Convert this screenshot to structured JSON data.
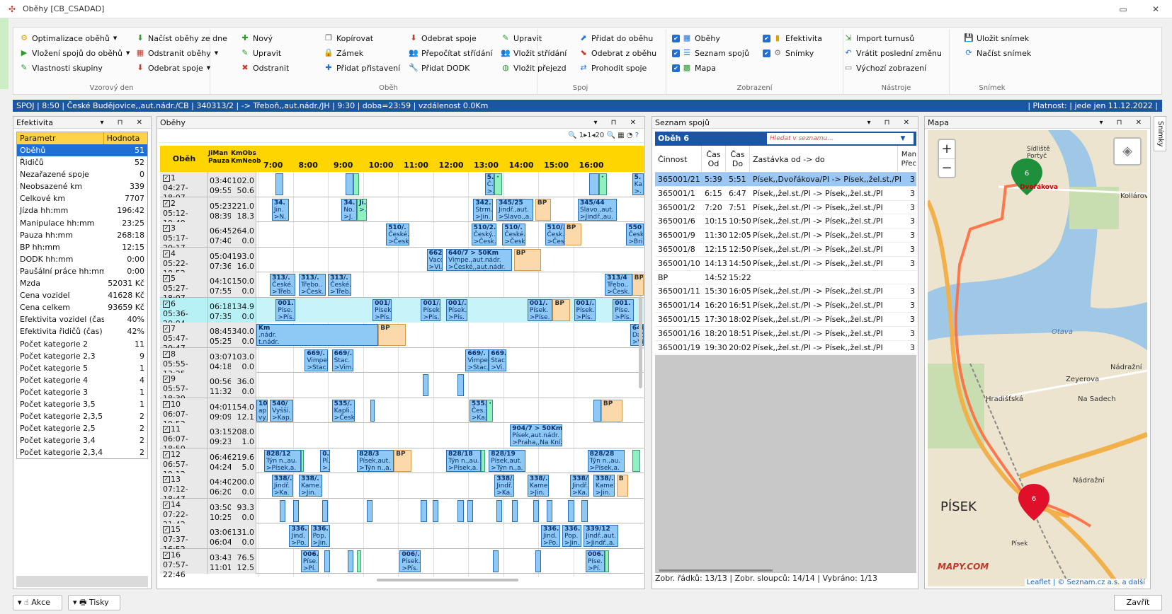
{
  "window": {
    "title": "Oběhy [CB_CSADAD]",
    "minimize": "▭",
    "close": "✕"
  },
  "ribbon": {
    "groups": {
      "vzorovy": {
        "title": "Vzorový den",
        "items": [
          "Optimalizace oběhů",
          "Vložení spojů do oběhů",
          "Vlastnosti skupiny",
          "Načíst oběhy ze dne",
          "Odstranit oběhy",
          "Odebrat spoje"
        ]
      },
      "obeh": {
        "title": "Oběh",
        "items": [
          "Nový",
          "Upravit",
          "Odstranit",
          "Kopírovat",
          "Zámek",
          "Přidat přistavení",
          "Odebrat spoje",
          "Přepočítat střídání",
          "Přidat DODK"
        ]
      },
      "spoj": {
        "title": "Spoj",
        "items": [
          "Upravit",
          "Vložit střídání",
          "Vložit přejezd",
          "Přidat do oběhu",
          "Odebrat z oběhu",
          "Prohodit spoje"
        ]
      },
      "zobrazeni": {
        "title": "Zobrazení",
        "items": [
          "Oběhy",
          "Seznam spojů",
          "Mapa",
          "Efektivita",
          "Snímky"
        ]
      },
      "nastroje": {
        "title": "Nástroje",
        "items": [
          "Import turnusů",
          "Vrátit poslední změnu",
          "Výchozí zobrazení"
        ]
      },
      "snimek": {
        "title": "Snímek",
        "items": [
          "Uložit snímek",
          "Načíst snímek"
        ]
      }
    }
  },
  "status": {
    "left": "SPOJ | 8:50 | České Budějovice,,aut.nádr./CB | 340313/2 |  -> Třeboň,,aut.nádr./JH | 9:30 | doba=23:59 | vzdálenost 0.0Km",
    "right": "| Platnost:  | jede jen 11.12.2022 |"
  },
  "efektivita": {
    "title": "Efektivita",
    "headers": [
      "Parametr",
      "Hodnota"
    ],
    "rows": [
      [
        "Oběhů",
        "51"
      ],
      [
        "Řidičů",
        "52"
      ],
      [
        "Nezařazené spoje",
        "0"
      ],
      [
        "Neobsazené km",
        "339"
      ],
      [
        "Celkové km",
        "7707"
      ],
      [
        "Jízda hh:mm",
        "196:42"
      ],
      [
        "Manipulace hh:mm",
        "23:25"
      ],
      [
        "Pauza hh:mm",
        "268:18"
      ],
      [
        "BP hh:mm",
        "12:15"
      ],
      [
        "DODK hh:mm",
        "0:00"
      ],
      [
        "Paušální práce hh:mm",
        "0:00"
      ],
      [
        "Mzda",
        "52031 Kč"
      ],
      [
        "Cena vozidel",
        "41628 Kč"
      ],
      [
        "Cena celkem",
        "93659 Kč"
      ],
      [
        "Efektivita vozidel (čas)",
        "40%"
      ],
      [
        "Efektivita řidičů (čas)",
        "42%"
      ],
      [
        "Počet kategorie 2",
        "11"
      ],
      [
        "Počet kategorie 2,3",
        "9"
      ],
      [
        "Počet kategorie 5",
        "1"
      ],
      [
        "Počet kategorie 4",
        "4"
      ],
      [
        "Počet kategorie 3",
        "1"
      ],
      [
        "Počet kategorie 3,5",
        "1"
      ],
      [
        "Počet kategorie 2,3,5",
        "2"
      ],
      [
        "Počet kategorie 2,5",
        "2"
      ],
      [
        "Počet kategorie 3,4",
        "2"
      ],
      [
        "Počet kategorie 2,3,4",
        "2"
      ]
    ]
  },
  "obehy": {
    "title": "Oběhy",
    "toolbar": {
      "zoom_text": "1▸1◂20"
    },
    "headers": {
      "obeh": "Oběh",
      "jiman": "JiMan",
      "pauza": "Pauza",
      "kmobs": "KmObs",
      "kmneob": "KmNeob"
    },
    "hours": [
      "7:00",
      "8:00",
      "9:00",
      "10:00",
      "11:00",
      "12:00",
      "13:00",
      "14:00",
      "15:00",
      "16:00"
    ],
    "rows": [
      {
        "n": "1",
        "time": "04:27-18:07",
        "a": "03:40",
        "b": "09:55",
        "c": "102.0",
        "d": "50.6",
        "blocks": [
          [
            0.05,
            0.07,
            "b",
            ""
          ],
          [
            0.23,
            0.25,
            "b",
            ""
          ],
          [
            0.25,
            0.265,
            "g",
            ""
          ],
          [
            0.59,
            0.615,
            "b",
            "5.|Č.|>."
          ],
          [
            0.615,
            0.635,
            "g",
            "·"
          ],
          [
            0.86,
            0.885,
            "b",
            ""
          ],
          [
            0.885,
            0.905,
            "g",
            "·"
          ],
          [
            0.97,
            1.0,
            "b",
            "5.|Ka.|>."
          ]
        ]
      },
      {
        "n": "2",
        "time": "05:12-19:49",
        "a": "05:23",
        "b": "08:39",
        "c": "221.0",
        "d": "18.3",
        "blocks": [
          [
            0.04,
            0.085,
            "b",
            "34.|Jin.|>N."
          ],
          [
            0.22,
            0.26,
            "b",
            "34.|No.|>J."
          ],
          [
            0.26,
            0.285,
            "g",
            "Ji.|>."
          ],
          [
            0.56,
            0.61,
            "b",
            "342.|Strm.|>Jin."
          ],
          [
            0.62,
            0.715,
            "b",
            "345/25|Jindř.,aut.|>Slavo.,a."
          ],
          [
            0.72,
            0.76,
            "p",
            "BP"
          ],
          [
            0.83,
            0.93,
            "b",
            "345/44|Slavo.,aut.|>Jindř.,au."
          ]
        ]
      },
      {
        "n": "3",
        "time": "05:17-20:17",
        "a": "06:45",
        "b": "07:40",
        "c": "264.0",
        "d": "0.0",
        "blocks": [
          [
            0.335,
            0.395,
            "b",
            "510/.|České.|>Česk."
          ],
          [
            0.555,
            0.62,
            "b",
            "510/2.|Český..|>Česk."
          ],
          [
            0.635,
            0.695,
            "b",
            "510/.|České.|>Česk."
          ],
          [
            0.745,
            0.795,
            "b",
            "510/.|Česk.|>Čes."
          ],
          [
            0.795,
            0.84,
            "p",
            "BP"
          ],
          [
            0.955,
            1.0,
            "b",
            "550|Česk|>Bri"
          ]
        ]
      },
      {
        "n": "4",
        "time": "05:22-18:52",
        "a": "05:04",
        "b": "07:36",
        "c": "193.0",
        "d": "16.0",
        "blocks": [
          [
            0.44,
            0.48,
            "b",
            "662/|Vaco.|>Vi."
          ],
          [
            0.49,
            0.66,
            "b",
            "640/7 > 50Km|Vimpe.,aut.nádr.|>České,,aut.nádr."
          ],
          [
            0.665,
            0.735,
            "p",
            "BP"
          ]
        ]
      },
      {
        "n": "5",
        "time": "05:27-18:07",
        "a": "04:10",
        "b": "07:55",
        "c": "150.0",
        "d": "0.0",
        "blocks": [
          [
            0.035,
            0.1,
            "b",
            "313/.|České.|>Třeb."
          ],
          [
            0.11,
            0.18,
            "b",
            "313/.|Třebo..|>Česk."
          ],
          [
            0.185,
            0.245,
            "b",
            "313/.|České.|>Třeb."
          ],
          [
            0.9,
            0.97,
            "b",
            "313/4|Třebo..|>Česk."
          ],
          [
            0.97,
            1.0,
            "p",
            "BP"
          ]
        ]
      },
      {
        "n": "6",
        "time": "05:36-20:04",
        "a": "06:18",
        "b": "07:35",
        "c": "134.9",
        "d": "0.0",
        "selected": true,
        "blocks": [
          [
            0.05,
            0.1,
            "b",
            "001.|Píse.|>Pís."
          ],
          [
            0.3,
            0.35,
            "b",
            "001/.|Písek.|>Pís."
          ],
          [
            0.425,
            0.475,
            "b",
            "001/.|Písek.|>Pís."
          ],
          [
            0.49,
            0.545,
            "b",
            "001/.|Písek.|>Pís."
          ],
          [
            0.7,
            0.765,
            "b",
            "001/.|Písek.|>Píse."
          ],
          [
            0.765,
            0.81,
            "p",
            "BP"
          ],
          [
            0.82,
            0.875,
            "b",
            "001/.|Písek.|>Pís."
          ],
          [
            0.92,
            0.975,
            "b",
            "001.|Píse.|>Pís."
          ]
        ]
      },
      {
        "n": "7",
        "time": "05:47-20:47",
        "a": "08:45",
        "b": "05:25",
        "c": "340.0",
        "d": "0.0",
        "blocks": [
          [
            0.0,
            0.315,
            "b",
            "Km|.nádr.|t.nádr."
          ],
          [
            0.315,
            0.385,
            "p",
            "BP"
          ],
          [
            0.965,
            1.0,
            "b",
            "646/|Dačic|>Vim"
          ]
        ]
      },
      {
        "n": "8",
        "time": "05:55-13:25",
        "a": "03:07",
        "b": "04:18",
        "c": "103.0",
        "d": "0.0",
        "blocks": [
          [
            0.125,
            0.185,
            "b",
            "669/.|Vimpe.|>Stac."
          ],
          [
            0.195,
            0.25,
            "b",
            "669/.|Stac.|>Vim."
          ],
          [
            0.54,
            0.6,
            "b",
            "669/.|Vimpe.|>Stac."
          ],
          [
            0.6,
            0.645,
            "b",
            "669.|Stac.|>Vi."
          ]
        ]
      },
      {
        "n": "9",
        "time": "05:57-18:30",
        "a": "00:56",
        "b": "11:32",
        "c": "36.0",
        "d": "0.0",
        "blocks": [
          [
            0.43,
            0.445,
            "b",
            ""
          ],
          [
            0.52,
            0.535,
            "b",
            ""
          ]
        ]
      },
      {
        "n": "10",
        "time": "06:07-19:52",
        "a": "04:01",
        "b": "09:09",
        "c": "154.0",
        "d": "12.1",
        "blocks": [
          [
            0.0,
            0.03,
            "b",
            "10.|apl.|vy."
          ],
          [
            0.035,
            0.095,
            "b",
            "540/|Vyšší.|>Kap."
          ],
          [
            0.195,
            0.255,
            "b",
            "535/.|Kapli..|>Česk."
          ],
          [
            0.295,
            0.305,
            "b",
            ""
          ],
          [
            0.55,
            0.595,
            "b",
            "535.|Čes.|>Ka."
          ],
          [
            0.595,
            0.61,
            "g",
            "·"
          ],
          [
            0.87,
            0.89,
            "b",
            ""
          ],
          [
            0.89,
            0.945,
            "p",
            "BP"
          ]
        ]
      },
      {
        "n": "11",
        "time": "06:07-18:50",
        "a": "03:15",
        "b": "09:23",
        "c": "208.0",
        "d": "1.0",
        "blocks": [
          [
            0.655,
            0.79,
            "b",
            "904/7 > 50Km|Písek,aut.nádr.|>Praha,,Na Kníž"
          ]
        ]
      },
      {
        "n": "12",
        "time": "06:57-19:12",
        "a": "06:46",
        "b": "04:24",
        "c": "219.6",
        "d": "5.0",
        "blocks": [
          [
            0.02,
            0.115,
            "b",
            "828/12|Týn n.,au.|>Písek,a."
          ],
          [
            0.115,
            0.12,
            "g",
            ""
          ],
          [
            0.165,
            0.19,
            "b",
            "0.|Pí.|>."
          ],
          [
            0.26,
            0.355,
            "b",
            "828/3|Písek,aut.|>Týn n.,a."
          ],
          [
            0.355,
            0.4,
            "p",
            "BP"
          ],
          [
            0.49,
            0.58,
            "b",
            "828/18|Týn n.,au.|>Písek,a."
          ],
          [
            0.58,
            0.59,
            "g",
            ""
          ],
          [
            0.6,
            0.695,
            "b",
            "828/19|Písek,aut.|>Týn n.,a."
          ],
          [
            0.855,
            0.95,
            "b",
            "828/28|Týn n.,au.|>Písek,a."
          ],
          [
            0.97,
            0.99,
            "g",
            ""
          ]
        ]
      },
      {
        "n": "13",
        "time": "07:12-18:47",
        "a": "04:40",
        "b": "06:20",
        "c": "200.0",
        "d": "0.0",
        "blocks": [
          [
            0.04,
            0.095,
            "b",
            "338/.|Jindř.|>Ka."
          ],
          [
            0.11,
            0.17,
            "b",
            "338/.|Kame.|>Jin."
          ],
          [
            0.615,
            0.665,
            "b",
            "338/.|Jindř.|>Ka."
          ],
          [
            0.7,
            0.755,
            "b",
            "338/.|Kame.|>Jin."
          ],
          [
            0.81,
            0.86,
            "b",
            "338/.|Jindř.|>Ka."
          ],
          [
            0.87,
            0.925,
            "b",
            "338/.|Kame.|>Jin."
          ],
          [
            0.93,
            0.96,
            "p",
            "B"
          ]
        ]
      },
      {
        "n": "14",
        "time": "07:22-21:42",
        "a": "03:50",
        "b": "10:25",
        "c": "93.3",
        "d": "0.0",
        "blocks": [
          [
            0.06,
            0.075,
            "b",
            ""
          ],
          [
            0.095,
            0.11,
            "b",
            ""
          ],
          [
            0.17,
            0.185,
            "b",
            ""
          ],
          [
            0.285,
            0.3,
            "b",
            ""
          ],
          [
            0.425,
            0.44,
            "b",
            ""
          ],
          [
            0.455,
            0.47,
            "b",
            ""
          ],
          [
            0.52,
            0.535,
            "b",
            ""
          ],
          [
            0.545,
            0.56,
            "b",
            ""
          ],
          [
            0.62,
            0.635,
            "b",
            ""
          ],
          [
            0.66,
            0.675,
            "b",
            ""
          ],
          [
            0.715,
            0.73,
            "b",
            ""
          ],
          [
            0.75,
            0.765,
            "b",
            ""
          ],
          [
            0.805,
            0.82,
            "b",
            ""
          ],
          [
            0.84,
            0.855,
            "b",
            ""
          ]
        ]
      },
      {
        "n": "15",
        "time": "07:37-16:52",
        "a": "03:06",
        "b": "06:04",
        "c": "131.0",
        "d": "0.0",
        "blocks": [
          [
            0.085,
            0.135,
            "b",
            "336.|Jind.|>Po."
          ],
          [
            0.14,
            0.19,
            "b",
            "336.|Pop.|>Jin."
          ],
          [
            0.735,
            0.785,
            "b",
            "336.|Jind.|>Po."
          ],
          [
            0.79,
            0.84,
            "b",
            "336.|Pop.|>Jin."
          ],
          [
            0.845,
            0.935,
            "b",
            "339/12|Jindř.,aut.|>Jindř.,a."
          ]
        ]
      },
      {
        "n": "16",
        "time": "07:57-22:46",
        "a": "03:43",
        "b": "11:01",
        "c": "76.5",
        "d": "12.5",
        "blocks": [
          [
            0.115,
            0.16,
            "b",
            "006.|Píse.|>Pí."
          ],
          [
            0.175,
            0.19,
            "b",
            ""
          ],
          [
            0.235,
            0.25,
            "b",
            ""
          ],
          [
            0.26,
            0.27,
            "g",
            ""
          ],
          [
            0.37,
            0.425,
            "b",
            "006/.|Písek.|>Pís."
          ],
          [
            0.61,
            0.625,
            "b",
            ""
          ],
          [
            0.72,
            0.735,
            "b",
            ""
          ],
          [
            0.85,
            0.9,
            "b",
            "006.|Píse.|>Pí."
          ],
          [
            0.9,
            0.91,
            "g",
            ""
          ]
        ]
      }
    ]
  },
  "seznam": {
    "title": "Seznam spojů",
    "obeh": "Oběh 6",
    "search_placeholder": "Hledat v seznamu...",
    "headers": {
      "cinnost": "Činnost",
      "cas_od": "Čas Od",
      "cas_do": "Čas Do",
      "zastavka": "Zastávka od -> do",
      "man": "Man Přec"
    },
    "rows": [
      [
        "365001/21",
        "5:39",
        "5:51",
        "Písek,,Dvořákova/PI -> Písek,,žel.st./PI",
        "3"
      ],
      [
        "365001/1",
        "6:15",
        "6:47",
        "Písek,,žel.st./PI -> Písek,,žel.st./PI",
        "3"
      ],
      [
        "365001/2",
        "7:20",
        "7:51",
        "Písek,,žel.st./PI -> Písek,,žel.st./PI",
        "3"
      ],
      [
        "365001/6",
        "10:15",
        "10:50",
        "Písek,,žel.st./PI -> Písek,,žel.st./PI",
        "3"
      ],
      [
        "365001/9",
        "11:30",
        "12:05",
        "Písek,,žel.st./PI -> Písek,,žel.st./PI",
        "3"
      ],
      [
        "365001/8",
        "12:15",
        "12:50",
        "Písek,,žel.st./PI -> Písek,,žel.st./PI",
        "3"
      ],
      [
        "365001/10",
        "14:13",
        "14:50",
        "Písek,,žel.st./PI -> Písek,,žel.st./PI",
        "3"
      ],
      [
        "BP",
        "14:52",
        "15:22",
        "",
        ""
      ],
      [
        "365001/11",
        "15:30",
        "16:05",
        "Písek,,žel.st./PI -> Písek,,žel.st./PI",
        "3"
      ],
      [
        "365001/14",
        "16:20",
        "16:51",
        "Písek,,žel.st./PI -> Písek,,žel.st./PI",
        "3"
      ],
      [
        "365001/15",
        "17:30",
        "18:02",
        "Písek,,žel.st./PI -> Písek,,žel.st./PI",
        "3"
      ],
      [
        "365001/16",
        "18:20",
        "18:51",
        "Písek,,žel.st./PI -> Písek,,žel.st./PI",
        "3"
      ],
      [
        "365001/19",
        "19:30",
        "20:02",
        "Písek,,žel.st./PI -> Písek,,žel.st./PI",
        "3"
      ]
    ],
    "footer": "Zobr. řádků:  13/13  | Zobr. sloupců:  14/14  | Vybráno:  1/13"
  },
  "mapa": {
    "title": "Mapa",
    "city": "PÍSEK",
    "labels": [
      "Sídliště Portyč",
      "Dvořákova",
      "Kollárova",
      "Zeyerova",
      "Na Sadech",
      "Nádražní",
      "Hradišťská",
      "Písek",
      "Otava",
      "Nádražní"
    ],
    "marker_green": "6",
    "marker_red": "6",
    "logo": "MAPY.COM",
    "attribution": "Leaflet | © Seznam.cz a.s. a další"
  },
  "side_tab": "Snímky",
  "bottom": {
    "akce": "Akce",
    "tisky": "Tisky",
    "zavrit": "Zavřít"
  }
}
